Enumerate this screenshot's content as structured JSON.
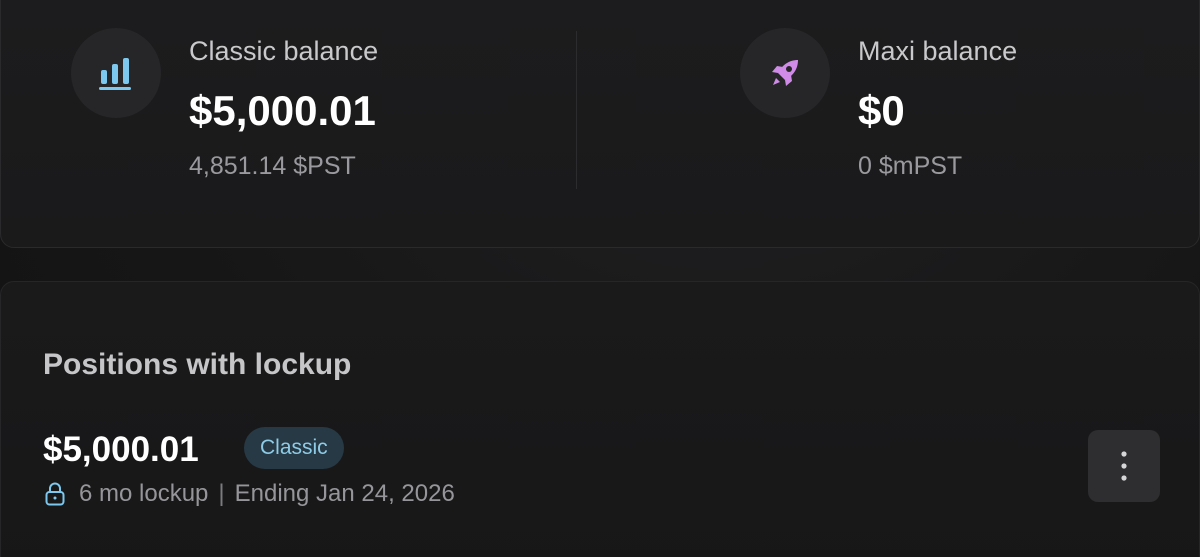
{
  "balances": {
    "classic": {
      "label": "Classic balance",
      "usd": "$5,000.01",
      "token": "4,851.14 $PST",
      "icon": "bar-chart-icon",
      "icon_color": "#7cc8ee"
    },
    "maxi": {
      "label": "Maxi balance",
      "usd": "$0",
      "token": "0 $mPST",
      "icon": "rocket-icon",
      "icon_color": "#d08be8"
    }
  },
  "positions": {
    "title": "Positions with lockup",
    "items": [
      {
        "amount": "$5,000.01",
        "badge": "Classic",
        "lockup": "6 mo lockup",
        "separator": "|",
        "ending": "Ending Jan 24, 2026",
        "icon": "lock-icon"
      }
    ]
  },
  "colors": {
    "badge_bg": "#263945",
    "badge_text": "#8ecbe6",
    "accent_blue": "#7cc8ee",
    "accent_purple": "#d08be8"
  }
}
